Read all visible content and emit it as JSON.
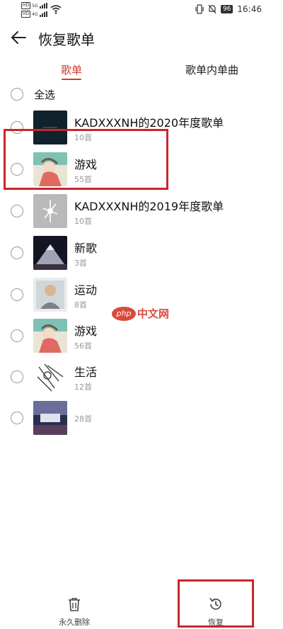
{
  "status": {
    "sim1": "HD",
    "sim2": "HD",
    "net1": "5G",
    "net2": "4G",
    "battery": "96",
    "time": "16:46"
  },
  "header": {
    "title": "恢复歌单"
  },
  "tabs": [
    {
      "label": "歌单",
      "active": true
    },
    {
      "label": "歌单内单曲",
      "active": false
    }
  ],
  "select_all_label": "全选",
  "playlists": [
    {
      "name": "KADXXXNH的2020年度歌单",
      "count": "10首"
    },
    {
      "name": "游戏",
      "count": "55首"
    },
    {
      "name": "KADXXXNH的2019年度歌单",
      "count": "10首"
    },
    {
      "name": "新歌",
      "count": "3首"
    },
    {
      "name": "运动",
      "count": "8首"
    },
    {
      "name": "游戏",
      "count": "56首"
    },
    {
      "name": "生活",
      "count": "12首"
    },
    {
      "name": "",
      "count": "28首"
    }
  ],
  "watermark": {
    "badge": "php",
    "text": "中文网"
  },
  "bottom": {
    "delete_label": "永久删除",
    "restore_label": "恢复"
  },
  "colors": {
    "accent": "#d33a31",
    "highlight": "#c8252d"
  }
}
